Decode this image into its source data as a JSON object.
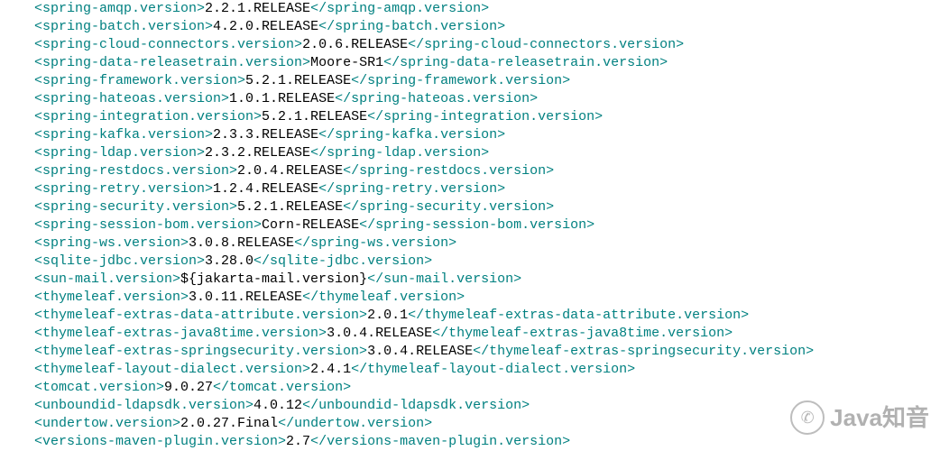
{
  "watermark": {
    "icon": "✆",
    "text": "Java知音"
  },
  "lines": [
    {
      "tag": "spring-amqp.version",
      "value": "2.2.1.RELEASE"
    },
    {
      "tag": "spring-batch.version",
      "value": "4.2.0.RELEASE"
    },
    {
      "tag": "spring-cloud-connectors.version",
      "value": "2.0.6.RELEASE"
    },
    {
      "tag": "spring-data-releasetrain.version",
      "value": "Moore-SR1"
    },
    {
      "tag": "spring-framework.version",
      "value": "5.2.1.RELEASE"
    },
    {
      "tag": "spring-hateoas.version",
      "value": "1.0.1.RELEASE"
    },
    {
      "tag": "spring-integration.version",
      "value": "5.2.1.RELEASE"
    },
    {
      "tag": "spring-kafka.version",
      "value": "2.3.3.RELEASE"
    },
    {
      "tag": "spring-ldap.version",
      "value": "2.3.2.RELEASE"
    },
    {
      "tag": "spring-restdocs.version",
      "value": "2.0.4.RELEASE"
    },
    {
      "tag": "spring-retry.version",
      "value": "1.2.4.RELEASE"
    },
    {
      "tag": "spring-security.version",
      "value": "5.2.1.RELEASE"
    },
    {
      "tag": "spring-session-bom.version",
      "value": "Corn-RELEASE"
    },
    {
      "tag": "spring-ws.version",
      "value": "3.0.8.RELEASE"
    },
    {
      "tag": "sqlite-jdbc.version",
      "value": "3.28.0"
    },
    {
      "tag": "sun-mail.version",
      "value": "${jakarta-mail.version}"
    },
    {
      "tag": "thymeleaf.version",
      "value": "3.0.11.RELEASE"
    },
    {
      "tag": "thymeleaf-extras-data-attribute.version",
      "value": "2.0.1"
    },
    {
      "tag": "thymeleaf-extras-java8time.version",
      "value": "3.0.4.RELEASE"
    },
    {
      "tag": "thymeleaf-extras-springsecurity.version",
      "value": "3.0.4.RELEASE"
    },
    {
      "tag": "thymeleaf-layout-dialect.version",
      "value": "2.4.1"
    },
    {
      "tag": "tomcat.version",
      "value": "9.0.27"
    },
    {
      "tag": "unboundid-ldapsdk.version",
      "value": "4.0.12"
    },
    {
      "tag": "undertow.version",
      "value": "2.0.27.Final"
    },
    {
      "tag": "versions-maven-plugin.version",
      "value": "2.7"
    }
  ]
}
